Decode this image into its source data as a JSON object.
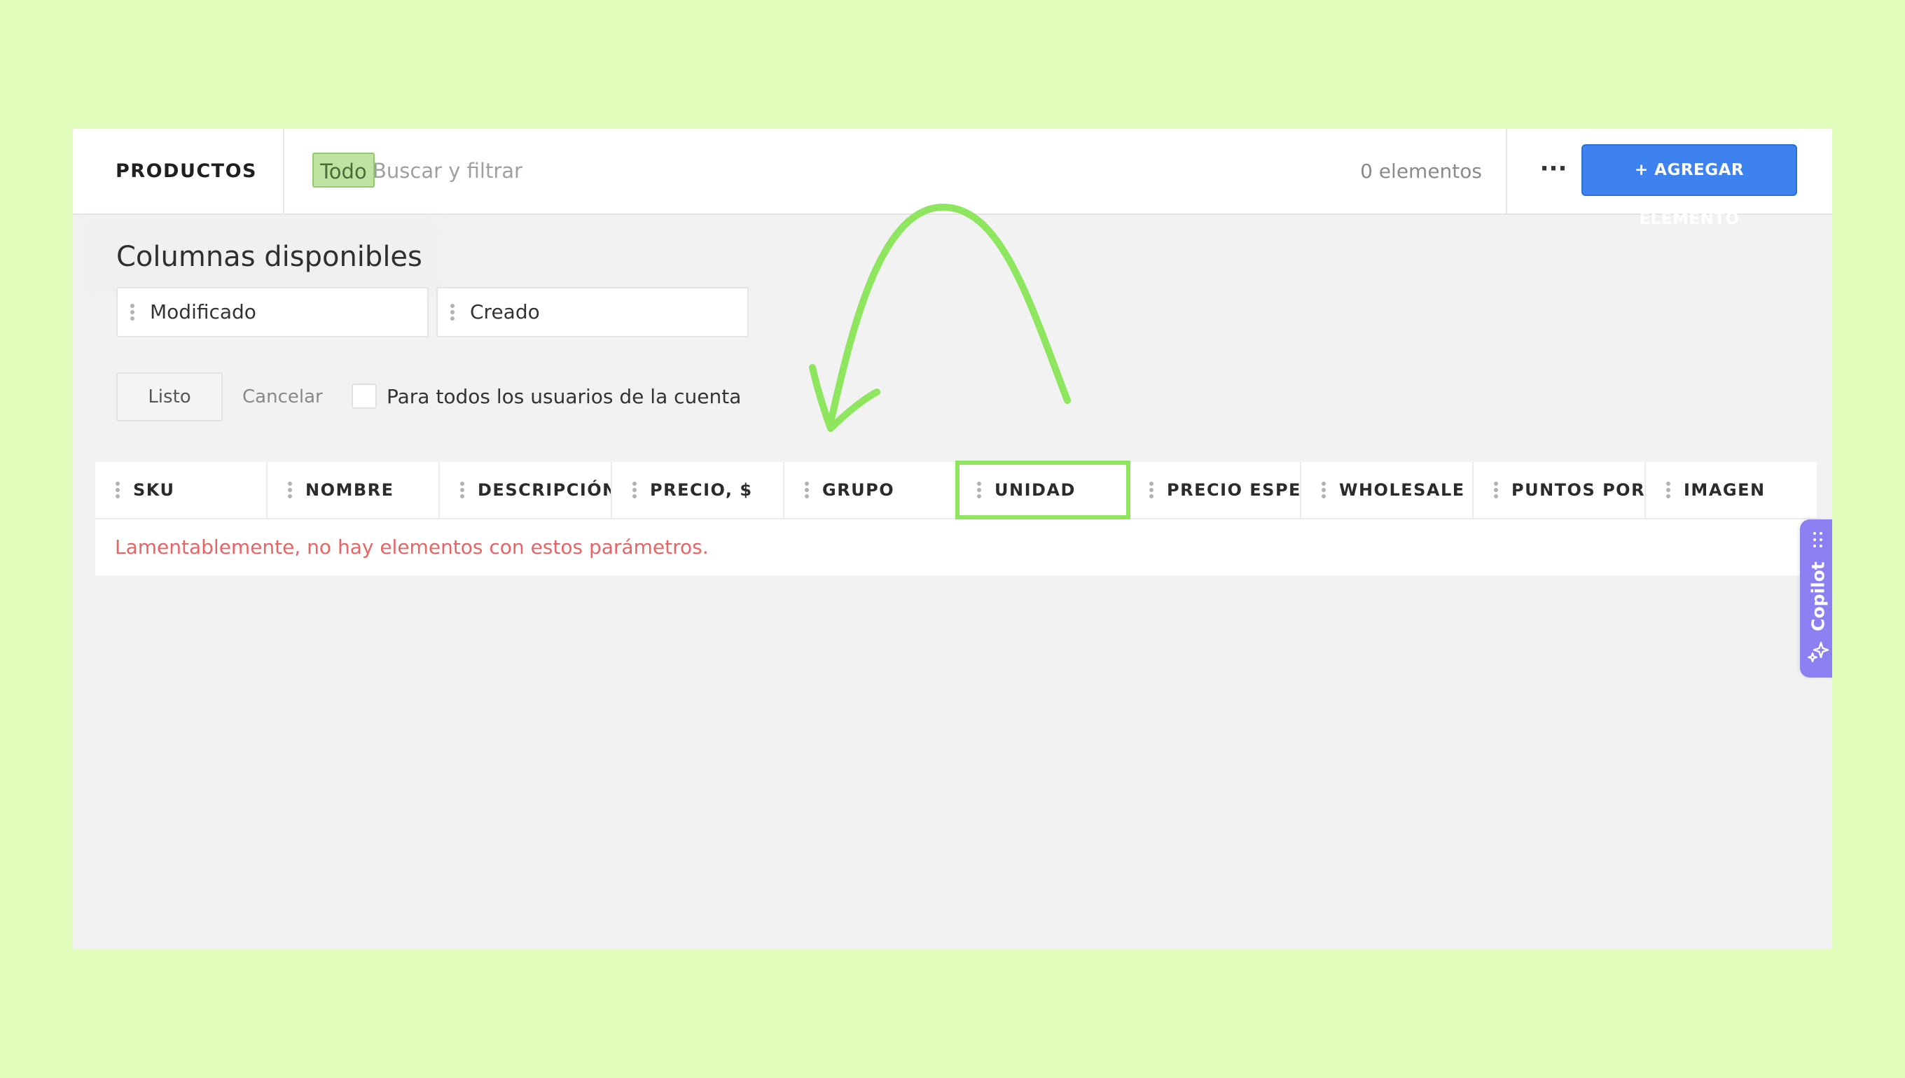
{
  "header": {
    "title": "PRODUCTOS",
    "filter_chip": "Todo",
    "search_placeholder": "Buscar y filtrar",
    "item_count": "0 elementos",
    "more_label": "···",
    "add_button_label": "+ AGREGAR ELEMENTO"
  },
  "column_picker": {
    "title": "Columnas disponibles",
    "available_columns": [
      "Modificado",
      "Creado"
    ],
    "done_label": "Listo",
    "cancel_label": "Cancelar",
    "all_users_label": "Para todos los usuarios de la cuenta",
    "all_users_checked": false
  },
  "table": {
    "columns": [
      "SKU",
      "NOMBRE",
      "DESCRIPCIÓN",
      "PRECIO, $",
      "GRUPO",
      "UNIDAD",
      "PRECIO ESPECIAL",
      "WHOLESALE PRICE",
      "PUNTOS POR COMPRA",
      "IMAGEN"
    ],
    "highlighted_column": "UNIDAD",
    "empty_message": "Lamentablemente, no hay elementos con estos parámetros."
  },
  "copilot": {
    "label": "Copilot"
  },
  "colors": {
    "page_background": "#e0fcba",
    "accent_blue": "#3e82ef",
    "highlight_green": "#8ee65f",
    "copilot_purple": "#8b7ff2",
    "error_red": "#e86464"
  },
  "icons": {
    "more": "more-dots-icon",
    "drag": "drag-handle-icon",
    "copilot_grip": "grip-icon",
    "copilot_sparkle": "sparkle-icon"
  }
}
